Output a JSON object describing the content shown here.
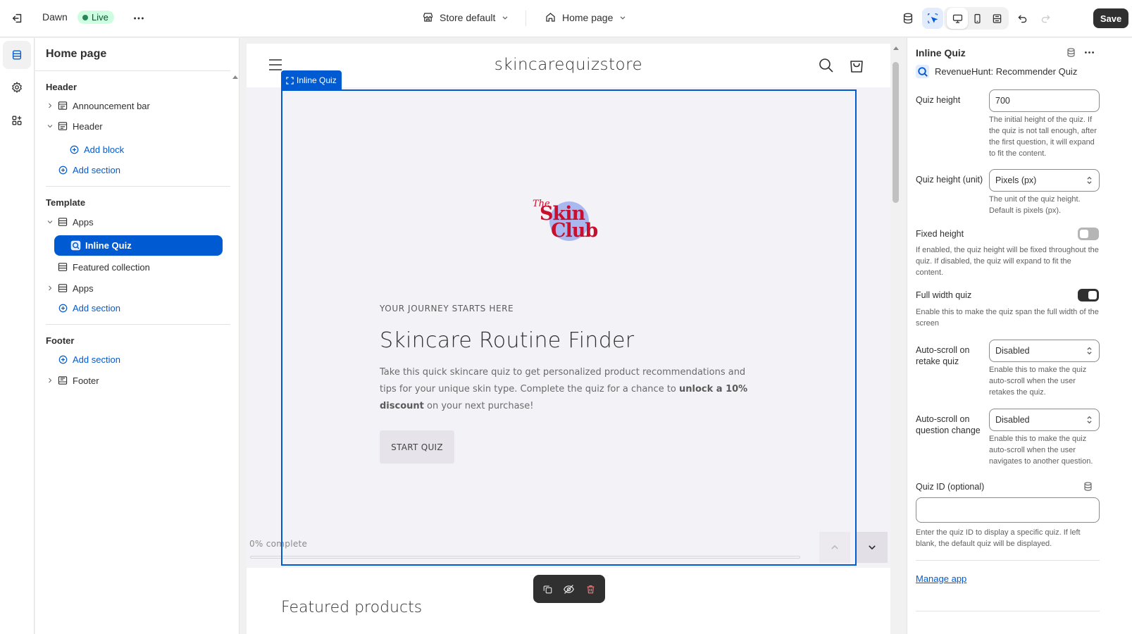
{
  "topbar": {
    "theme_name": "Dawn",
    "status_badge": "Live",
    "store_selector": "Store default",
    "page_selector": "Home page",
    "save_label": "Save"
  },
  "sections_panel": {
    "title": "Home page",
    "header_group": {
      "title": "Header",
      "items": [
        {
          "label": "Announcement bar"
        },
        {
          "label": "Header"
        }
      ],
      "add_block": "Add block",
      "add_section": "Add section"
    },
    "template_group": {
      "title": "Template",
      "items": [
        {
          "label": "Apps"
        },
        {
          "label": "Inline Quiz"
        },
        {
          "label": "Featured collection"
        },
        {
          "label": "Apps"
        }
      ],
      "add_section": "Add section"
    },
    "footer_group": {
      "title": "Footer",
      "add_section": "Add section",
      "items": [
        {
          "label": "Footer"
        }
      ]
    }
  },
  "preview": {
    "store_name": "skincarequizstore",
    "selection_tag": "Inline Quiz",
    "logo": {
      "line1": "The",
      "line2": "Skin",
      "line3": "Club"
    },
    "eyebrow": "YOUR JOURNEY STARTS HERE",
    "title": "Skincare Routine Finder",
    "description_start": "Take this quick skincare quiz to get personalized product recommendations and tips for your unique skin type. Complete the quiz for a chance to ",
    "description_bold": "unlock a 10% discount",
    "description_end": " on your next purchase!",
    "start_button": "START QUIZ",
    "progress_label": "0% complete",
    "progress_value": 0,
    "featured_heading": "Featured products"
  },
  "settings": {
    "title": "Inline Quiz",
    "app_name": "RevenueHunt: Recommender Quiz",
    "quiz_height": {
      "label": "Quiz height",
      "value": "700",
      "help": "The initial height of the quiz. If the quiz is not tall enough, after the first question, it will expand to fit the content."
    },
    "quiz_height_unit": {
      "label": "Quiz height (unit)",
      "value": "Pixels (px)",
      "help": "The unit of the quiz height. Default is pixels (px)."
    },
    "fixed_height": {
      "label": "Fixed height",
      "enabled": false,
      "help": "If enabled, the quiz height will be fixed throughout the quiz. If disabled, the quiz will expand to fit the content."
    },
    "full_width": {
      "label": "Full width quiz",
      "enabled": true,
      "help": "Enable this to make the quiz span the full width of the screen"
    },
    "autoscroll_retake": {
      "label": "Auto-scroll on retake quiz",
      "value": "Disabled",
      "help": "Enable this to make the quiz auto-scroll when the user retakes the quiz."
    },
    "autoscroll_question": {
      "label": "Auto-scroll on question change",
      "value": "Disabled",
      "help": "Enable this to make the quiz auto-scroll when the user navigates to another question."
    },
    "quiz_id": {
      "label": "Quiz ID (optional)",
      "value": "",
      "help": "Enter the quiz ID to display a specific quiz. If left blank, the default quiz will be displayed."
    },
    "manage_app": "Manage app"
  },
  "colors": {
    "accent_blue": "#005bd3",
    "live_green": "#29845a",
    "logo_red": "#c8102e",
    "logo_circle": "#aab8f0"
  }
}
